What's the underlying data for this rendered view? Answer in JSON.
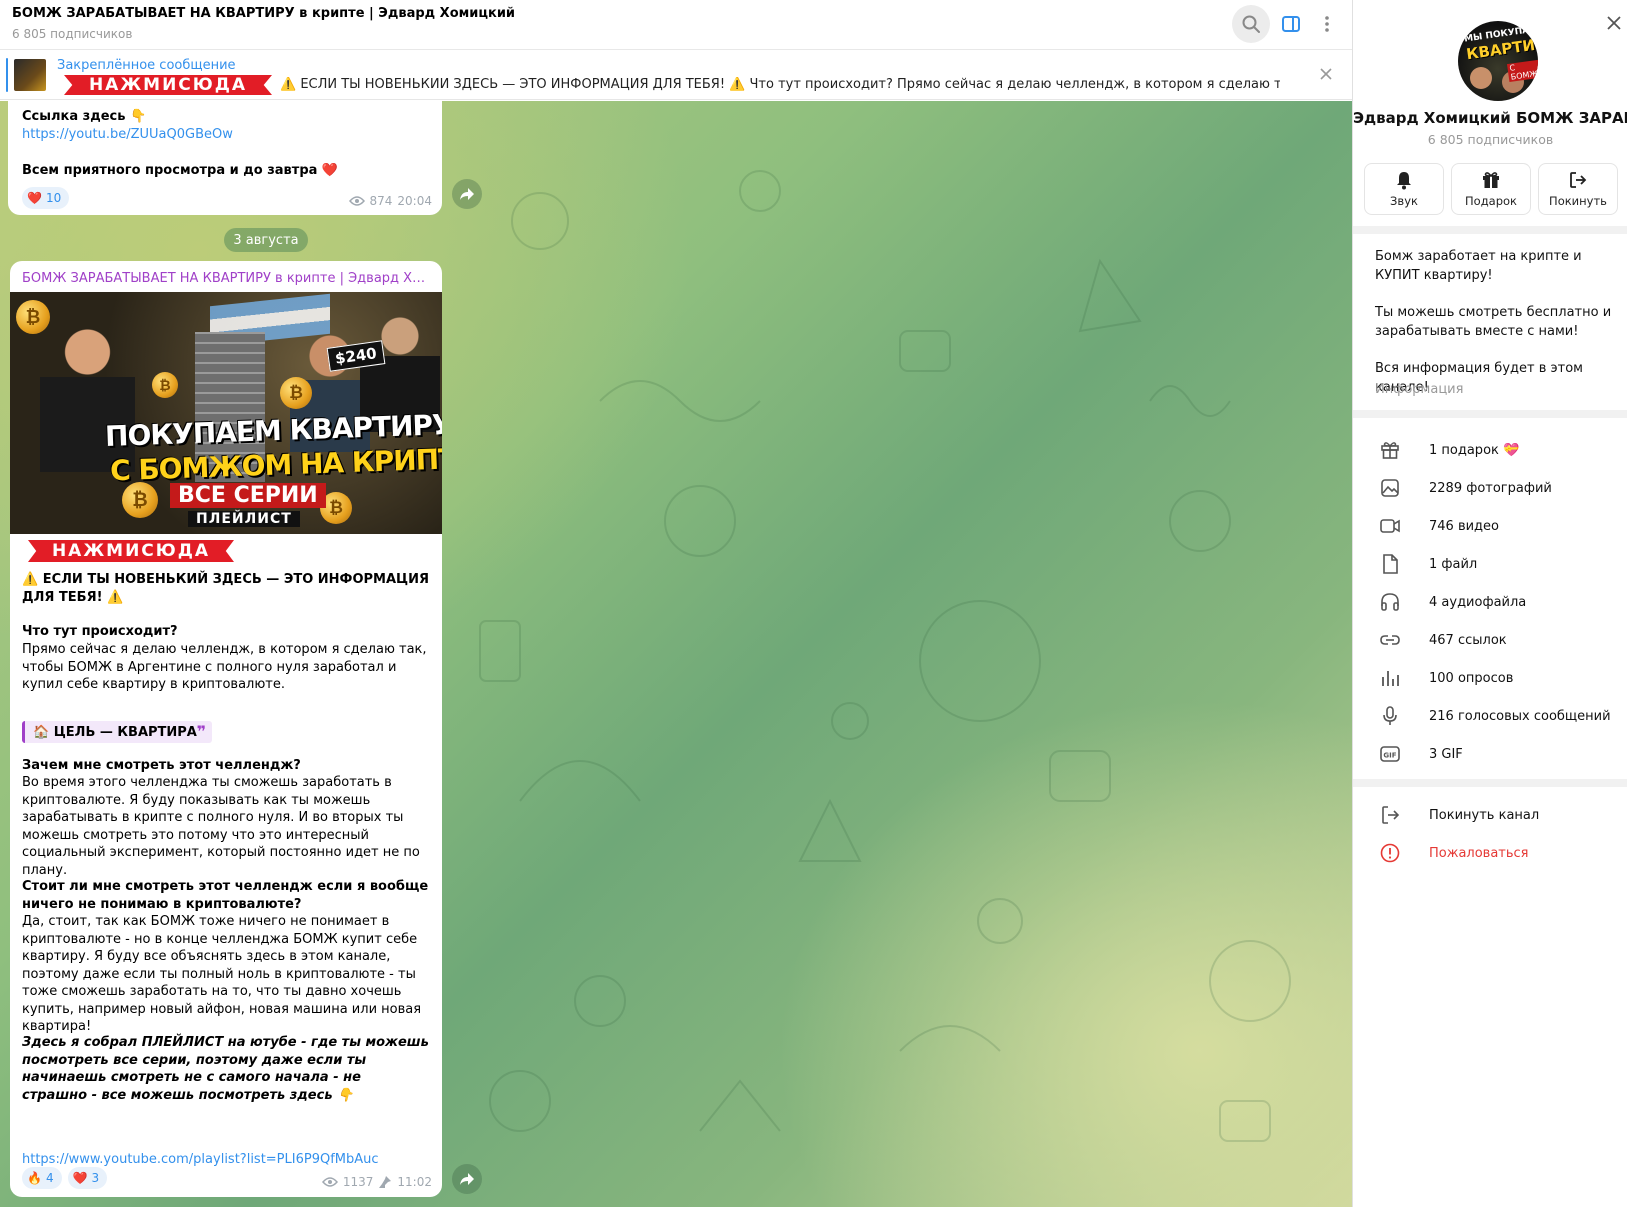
{
  "colors": {
    "accent": "#3390ec",
    "author": "#a040c8",
    "danger": "#e53935",
    "banner": "#e21d26"
  },
  "header": {
    "title": "БОМЖ ЗАРАБАТЫВАЕТ НА КВАРТИРУ в крипте | Эдвард Хомицкий",
    "subscribers": "6 805 подписчиков",
    "icons": [
      "search-icon",
      "sidebar-toggle-icon",
      "more-vertical-icon"
    ]
  },
  "pinned": {
    "label": "Закреплённое сообщение",
    "banner": "НАЖМИСЮДА",
    "text": "⚠️ ЕСЛИ ТЫ НОВЕНЬКИЙ ЗДЕСЬ — ЭТО ИНФОРМАЦИЯ ДЛЯ ТЕБЯ! ⚠️  Что тут происходит? Прямо сейчас я делаю челлендж, в котором я сделаю так, чтобы Б..."
  },
  "message1": {
    "line1": "Ссылка здесь 👇",
    "link": "https://youtu.be/ZUUaQ0GBeOw",
    "line2": "Всем приятного просмотра и до завтра ❤️",
    "reaction_emoji": "❤️",
    "reaction_count": "10",
    "views": "874",
    "time": "20:04"
  },
  "date_divider": "3 августа",
  "message2": {
    "author": "БОМЖ ЗАРАБАТЫВАЕТ НА КВАРТИРУ в крипте | Эдвард Хомицкий",
    "thumb": {
      "price": "$240",
      "headline1": "ПОКУПАЕМ КВАРТИРУ",
      "headline2": "С БОМЖОМ НА КРИПТЕ",
      "headline3": "ВСЕ СЕРИИ",
      "headline4": "ПЛЕЙЛИСТ"
    },
    "banner": "НАЖМИСЮДА",
    "p1": "⚠️ ЕСЛИ ТЫ НОВЕНЬКИЙ ЗДЕСЬ — ЭТО ИНФОРМАЦИЯ ДЛЯ ТЕБЯ! ⚠️",
    "q1": "Что тут происходит?",
    "a1": "Прямо сейчас я делаю челлендж, в котором я сделаю так, чтобы БОМЖ в Аргентине с полного нуля заработал и купил себе квартиру в криптовалюте.",
    "quote": "🏠 ЦЕЛЬ — КВАРТИРА",
    "q2": "Зачем мне смотреть этот челлендж?",
    "a2": "Во время этого челленджа ты сможешь заработать в криптовалюте. Я буду показывать как ты можешь зарабатывать в крипте с полного нуля. И во вторых ты можешь смотреть это потому что это интересный социальный эксперимент, который постоянно идет не по плану.",
    "q3": "Стоит ли мне смотреть этот челлендж если я вообще ничего не понимаю в криптовалюте?",
    "a3": "Да, стоит, так как БОМЖ тоже ничего не понимает в криптовалюте - но в конце челленджа БОМЖ купит себе квартиру. Я буду все объяснять здесь в этом канале, поэтому даже если ты полный ноль в криптовалюте - ты тоже сможешь заработать на то, что ты давно хочешь купить, например новый айфон, новая машина или новая квартира!",
    "italic": "Здесь я собрал ПЛЕЙЛИСТ на ютубе - где ты можешь посмотреть все серии, поэтому даже если ты начинаешь смотреть не с самого начала - не страшно - все можешь посмотреть здесь 👇",
    "link": "https://www.youtube.com/playlist?list=PLI6P9QfMbAuc",
    "reactions": [
      {
        "emoji": "🔥",
        "count": "4"
      },
      {
        "emoji": "❤️",
        "count": "3"
      }
    ],
    "views": "1137",
    "time": "11:02"
  },
  "panel": {
    "avatar_text1": "МЫ ПОКУПАЕМ",
    "avatar_text2": "КВАРТИРУ",
    "avatar_text3": "С БОМЖОМ",
    "name": "Эдвард Хомицкий    БОМЖ ЗАРАБАТЫВАЕТ",
    "subscribers": "6 805 подписчиков",
    "buttons": [
      {
        "label": "Звук",
        "icon": "bell-icon"
      },
      {
        "label": "Подарок",
        "icon": "gift-icon"
      },
      {
        "label": "Покинуть",
        "icon": "leave-icon"
      }
    ],
    "description": [
      "Бомж заработает на крипте и КУПИТ квартиру!",
      "Ты можешь смотреть бесплатно и зарабатывать вместе с нами!",
      "Вся информация будет в этом канале!"
    ],
    "info_label": "Информация",
    "media": [
      {
        "label": "1 подарок 💝",
        "icon": "gift-icon"
      },
      {
        "label": "2289 фотографий",
        "icon": "photo-icon"
      },
      {
        "label": "746 видео",
        "icon": "video-icon"
      },
      {
        "label": "1 файл",
        "icon": "file-icon"
      },
      {
        "label": "4 аудиофайла",
        "icon": "headphones-icon"
      },
      {
        "label": "467 ссылок",
        "icon": "link-icon"
      },
      {
        "label": "100 опросов",
        "icon": "poll-icon"
      },
      {
        "label": "216 голосовых сообщений",
        "icon": "microphone-icon"
      },
      {
        "label": "3 GIF",
        "icon": "gif-icon"
      }
    ],
    "actions": [
      {
        "label": "Покинуть канал",
        "icon": "leave-icon"
      },
      {
        "label": "Пожаловаться",
        "icon": "report-icon"
      }
    ]
  }
}
